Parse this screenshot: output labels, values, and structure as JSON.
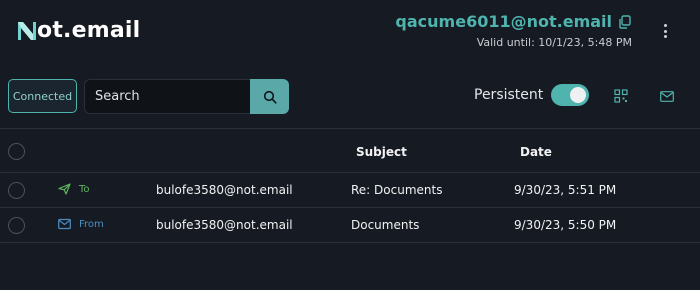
{
  "app": {
    "logo_text": "ot.email",
    "logo_mark_icon": "n-logo-mark"
  },
  "account": {
    "email": "qacume6011@not.email",
    "valid_until": "Valid until: 10/1/23, 5:48 PM",
    "copy_icon": "copy-icon",
    "menu_icon": "kebab-menu-icon"
  },
  "toolbar": {
    "connected_label": "Connected",
    "search_placeholder": "Search",
    "search_icon": "search-icon",
    "persistent_label": "Persistent",
    "persistent_on": true,
    "qr_icon": "qr-code-icon",
    "mail_icon": "mail-icon"
  },
  "table": {
    "headers": {
      "subject": "Subject",
      "date": "Date"
    },
    "rows": [
      {
        "direction": "To",
        "direction_icon": "send-icon",
        "address": "bulofe3580@not.email",
        "subject": "Re: Documents",
        "date": "9/30/23, 5:51 PM"
      },
      {
        "direction": "From",
        "direction_icon": "envelope-icon",
        "address": "bulofe3580@not.email",
        "subject": "Documents",
        "date": "9/30/23, 5:50 PM"
      }
    ]
  },
  "colors": {
    "background": "#161a22",
    "accent": "#4fb3ae",
    "to_color": "#5fb55f",
    "from_color": "#4a8fc4",
    "divider": "#2a2f38"
  }
}
